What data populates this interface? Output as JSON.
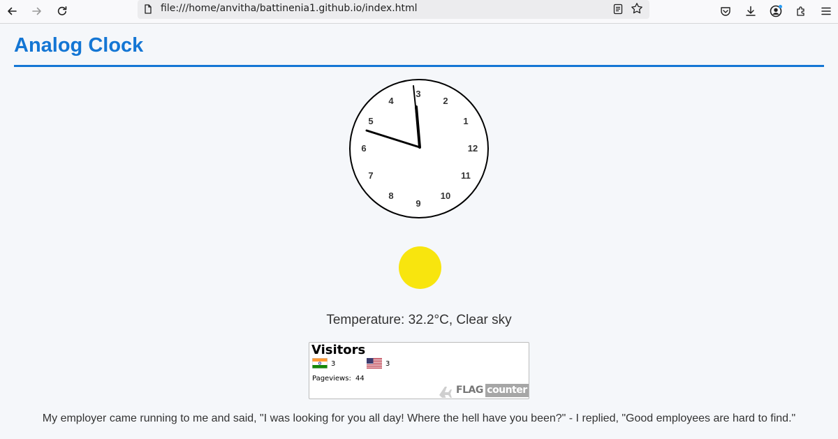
{
  "browser": {
    "url": "file:///home/anvitha/battinenia1.github.io/index.html",
    "icons": {
      "back": "back-arrow-icon",
      "forward": "forward-arrow-icon",
      "reload": "reload-icon",
      "page": "page-document-icon",
      "reader": "reader-view-icon",
      "bookmark": "star-bookmark-icon",
      "pocket": "pocket-icon",
      "downloads": "download-icon",
      "account": "account-icon",
      "extensions": "extensions-puzzle-icon",
      "menu": "hamburger-menu-icon"
    }
  },
  "page": {
    "title": "Analog Clock",
    "accent_color": "#1476d4"
  },
  "clock": {
    "numerals": [
      "1",
      "2",
      "3",
      "4",
      "5",
      "6",
      "7",
      "8",
      "9",
      "10",
      "11",
      "12"
    ]
  },
  "weather": {
    "text": "Temperature: 32.2°C, Clear sky",
    "icon": "sun-icon",
    "sun_color": "#f8e50e"
  },
  "flag_counter": {
    "title": "Visitors",
    "countries": [
      {
        "flag": "india-flag-icon",
        "count": "3"
      },
      {
        "flag": "usa-flag-icon",
        "count": "3"
      }
    ],
    "pageviews_label": "Pageviews:",
    "pageviews_value": "44",
    "logo_flag": "FLAG",
    "logo_counter": "counter"
  },
  "joke": "My employer came running to me and said, \"I was looking for you all day! Where the hell have you been?\" - I replied, \"Good employees are hard to find.\""
}
